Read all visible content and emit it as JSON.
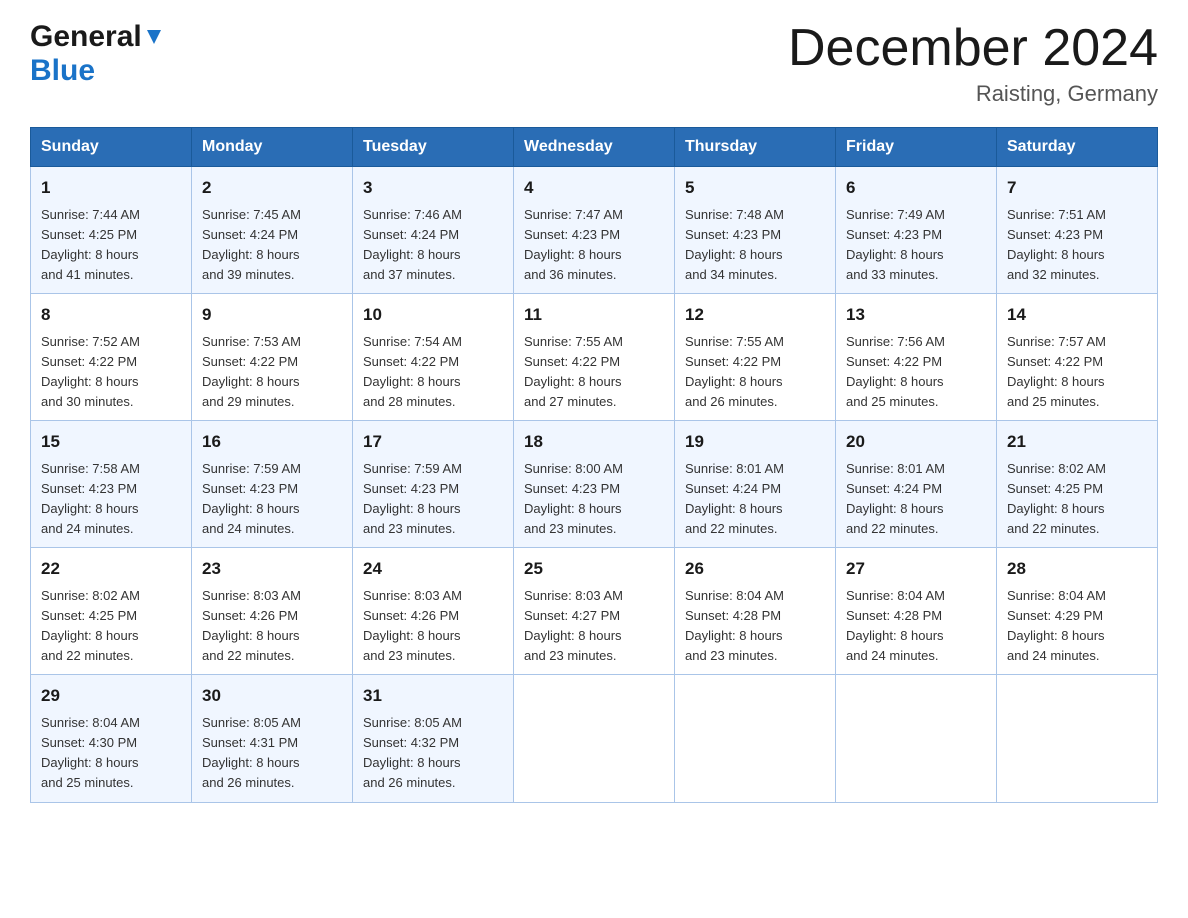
{
  "header": {
    "logo_general": "General",
    "logo_blue": "Blue",
    "month_title": "December 2024",
    "location": "Raisting, Germany"
  },
  "days_of_week": [
    "Sunday",
    "Monday",
    "Tuesday",
    "Wednesday",
    "Thursday",
    "Friday",
    "Saturday"
  ],
  "weeks": [
    [
      {
        "day": "1",
        "sunrise": "7:44 AM",
        "sunset": "4:25 PM",
        "daylight": "8 hours and 41 minutes."
      },
      {
        "day": "2",
        "sunrise": "7:45 AM",
        "sunset": "4:24 PM",
        "daylight": "8 hours and 39 minutes."
      },
      {
        "day": "3",
        "sunrise": "7:46 AM",
        "sunset": "4:24 PM",
        "daylight": "8 hours and 37 minutes."
      },
      {
        "day": "4",
        "sunrise": "7:47 AM",
        "sunset": "4:23 PM",
        "daylight": "8 hours and 36 minutes."
      },
      {
        "day": "5",
        "sunrise": "7:48 AM",
        "sunset": "4:23 PM",
        "daylight": "8 hours and 34 minutes."
      },
      {
        "day": "6",
        "sunrise": "7:49 AM",
        "sunset": "4:23 PM",
        "daylight": "8 hours and 33 minutes."
      },
      {
        "day": "7",
        "sunrise": "7:51 AM",
        "sunset": "4:23 PM",
        "daylight": "8 hours and 32 minutes."
      }
    ],
    [
      {
        "day": "8",
        "sunrise": "7:52 AM",
        "sunset": "4:22 PM",
        "daylight": "8 hours and 30 minutes."
      },
      {
        "day": "9",
        "sunrise": "7:53 AM",
        "sunset": "4:22 PM",
        "daylight": "8 hours and 29 minutes."
      },
      {
        "day": "10",
        "sunrise": "7:54 AM",
        "sunset": "4:22 PM",
        "daylight": "8 hours and 28 minutes."
      },
      {
        "day": "11",
        "sunrise": "7:55 AM",
        "sunset": "4:22 PM",
        "daylight": "8 hours and 27 minutes."
      },
      {
        "day": "12",
        "sunrise": "7:55 AM",
        "sunset": "4:22 PM",
        "daylight": "8 hours and 26 minutes."
      },
      {
        "day": "13",
        "sunrise": "7:56 AM",
        "sunset": "4:22 PM",
        "daylight": "8 hours and 25 minutes."
      },
      {
        "day": "14",
        "sunrise": "7:57 AM",
        "sunset": "4:22 PM",
        "daylight": "8 hours and 25 minutes."
      }
    ],
    [
      {
        "day": "15",
        "sunrise": "7:58 AM",
        "sunset": "4:23 PM",
        "daylight": "8 hours and 24 minutes."
      },
      {
        "day": "16",
        "sunrise": "7:59 AM",
        "sunset": "4:23 PM",
        "daylight": "8 hours and 24 minutes."
      },
      {
        "day": "17",
        "sunrise": "7:59 AM",
        "sunset": "4:23 PM",
        "daylight": "8 hours and 23 minutes."
      },
      {
        "day": "18",
        "sunrise": "8:00 AM",
        "sunset": "4:23 PM",
        "daylight": "8 hours and 23 minutes."
      },
      {
        "day": "19",
        "sunrise": "8:01 AM",
        "sunset": "4:24 PM",
        "daylight": "8 hours and 22 minutes."
      },
      {
        "day": "20",
        "sunrise": "8:01 AM",
        "sunset": "4:24 PM",
        "daylight": "8 hours and 22 minutes."
      },
      {
        "day": "21",
        "sunrise": "8:02 AM",
        "sunset": "4:25 PM",
        "daylight": "8 hours and 22 minutes."
      }
    ],
    [
      {
        "day": "22",
        "sunrise": "8:02 AM",
        "sunset": "4:25 PM",
        "daylight": "8 hours and 22 minutes."
      },
      {
        "day": "23",
        "sunrise": "8:03 AM",
        "sunset": "4:26 PM",
        "daylight": "8 hours and 22 minutes."
      },
      {
        "day": "24",
        "sunrise": "8:03 AM",
        "sunset": "4:26 PM",
        "daylight": "8 hours and 23 minutes."
      },
      {
        "day": "25",
        "sunrise": "8:03 AM",
        "sunset": "4:27 PM",
        "daylight": "8 hours and 23 minutes."
      },
      {
        "day": "26",
        "sunrise": "8:04 AM",
        "sunset": "4:28 PM",
        "daylight": "8 hours and 23 minutes."
      },
      {
        "day": "27",
        "sunrise": "8:04 AM",
        "sunset": "4:28 PM",
        "daylight": "8 hours and 24 minutes."
      },
      {
        "day": "28",
        "sunrise": "8:04 AM",
        "sunset": "4:29 PM",
        "daylight": "8 hours and 24 minutes."
      }
    ],
    [
      {
        "day": "29",
        "sunrise": "8:04 AM",
        "sunset": "4:30 PM",
        "daylight": "8 hours and 25 minutes."
      },
      {
        "day": "30",
        "sunrise": "8:05 AM",
        "sunset": "4:31 PM",
        "daylight": "8 hours and 26 minutes."
      },
      {
        "day": "31",
        "sunrise": "8:05 AM",
        "sunset": "4:32 PM",
        "daylight": "8 hours and 26 minutes."
      },
      null,
      null,
      null,
      null
    ]
  ],
  "labels": {
    "sunrise": "Sunrise:",
    "sunset": "Sunset:",
    "daylight": "Daylight:"
  }
}
